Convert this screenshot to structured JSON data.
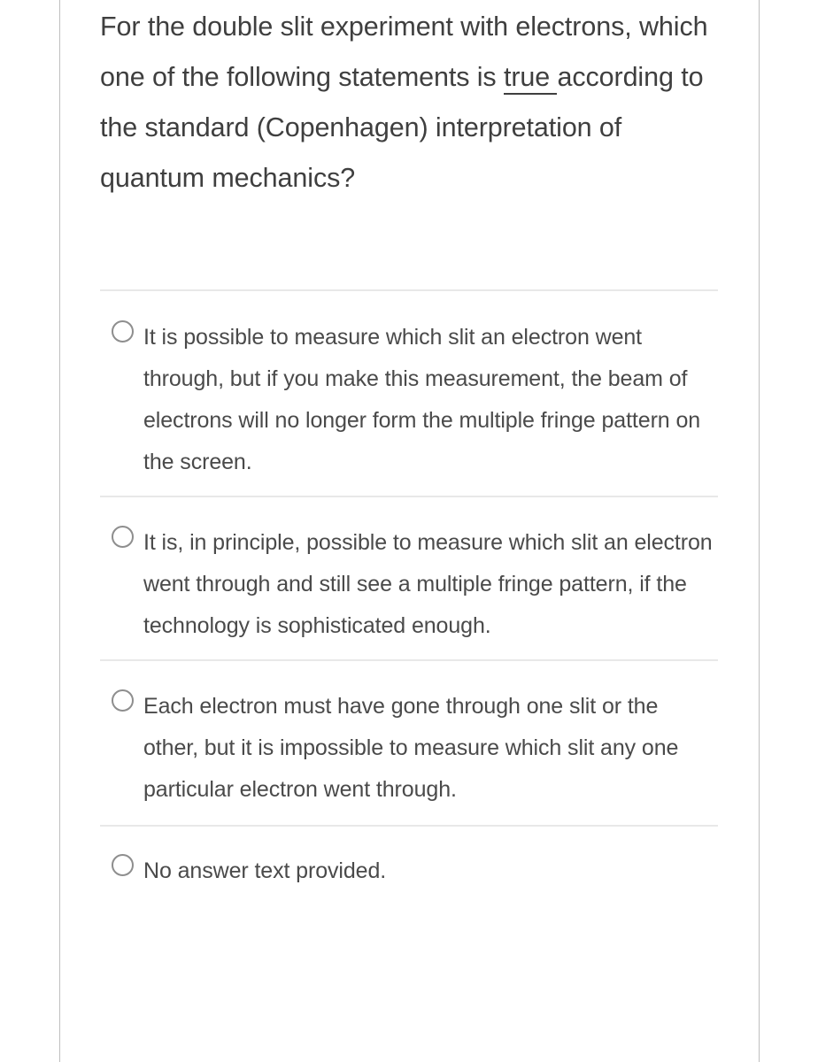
{
  "question": {
    "text_before_emphasis": "For the double slit experiment with electrons, which one of the following statements is ",
    "emphasized_word": "true ",
    "text_after_emphasis": "according to the standard (Copenhagen) interpretation of quantum mechanics?",
    "full_text": "For the double slit experiment with electrons, which one of the following statements is true according to the standard (Copenhagen) interpretation of quantum mechanics?"
  },
  "answers": {
    "input_type": "radio",
    "selected_index": null,
    "options": [
      {
        "id": "option-1",
        "icon": "radio-unchecked-icon",
        "label": "It is possible to measure which slit an electron went through, but if you make this measurement, the beam of electrons will no longer form the multiple fringe pattern on the screen.",
        "selected": false
      },
      {
        "id": "option-2",
        "icon": "radio-unchecked-icon",
        "label": "It is, in principle, possible to measure which slit an electron went through and still see a multiple fringe pattern, if the technology is sophisticated enough.",
        "selected": false
      },
      {
        "id": "option-3",
        "icon": "radio-unchecked-icon",
        "label": "Each electron must have gone through one slit or the other, but it is impossible to measure which slit any one particular electron went through.",
        "selected": false
      },
      {
        "id": "option-4",
        "icon": "radio-unchecked-icon",
        "label": "No answer text provided.",
        "selected": false
      }
    ]
  },
  "scrollbar": {
    "orientation": "vertical",
    "thumb_position": "top"
  },
  "colors": {
    "page_background": "#ffffff",
    "question_text": "#3f3f3f",
    "option_text": "#4a4a4a",
    "divider": "#e8e8e8",
    "frame_border": "#bfbfbf",
    "radio_outline": "#8e8e8e",
    "scrollbar_thumb": "#a8a8a8"
  }
}
